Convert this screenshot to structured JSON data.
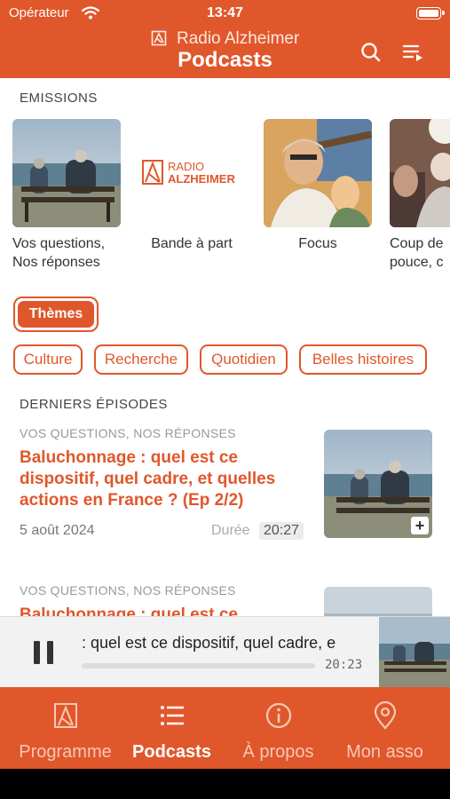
{
  "status": {
    "carrier": "Opérateur",
    "time": "13:47"
  },
  "header": {
    "brand": "Radio Alzheimer",
    "title": "Podcasts"
  },
  "emissions": {
    "label": "EMISSIONS",
    "items": [
      {
        "line1": "Vos questions,",
        "line2": "Nos réponses"
      },
      {
        "line1": "Bande à part",
        "line2": "",
        "logo_top": "RADIO",
        "logo_bottom": "ALZHEIMER"
      },
      {
        "line1": "Focus",
        "line2": ""
      },
      {
        "line1": "Coup de",
        "line2": "pouce, c"
      }
    ]
  },
  "themes": {
    "label": "Thèmes",
    "chips": [
      "Culture",
      "Recherche",
      "Quotidien",
      "Belles histoires"
    ]
  },
  "episodes": {
    "label": "DERNIERS ÉPISODES",
    "items": [
      {
        "show": "VOS QUESTIONS, NOS RÉPONSES",
        "title": "Baluchonnage : quel est ce dispositif, quel cadre, et quelles actions en France ? (Ep 2/2)",
        "date": "5 août 2024",
        "duration_label": "Durée",
        "duration": "20:27"
      },
      {
        "show": "VOS QUESTIONS, NOS RÉPONSES",
        "title": "Baluchonnage : quel est ce"
      }
    ]
  },
  "player": {
    "title": ": quel est ce dispositif, quel cadre, e",
    "time": "20:23",
    "progress": 0.0
  },
  "tabs": [
    {
      "label": "Programme",
      "icon": "radio-logo-icon",
      "active": false
    },
    {
      "label": "Podcasts",
      "icon": "list-icon",
      "active": true
    },
    {
      "label": "À propos",
      "icon": "info-icon",
      "active": false
    },
    {
      "label": "Mon asso",
      "icon": "location-pin-icon",
      "active": false
    }
  ],
  "colors": {
    "accent": "#e0572b",
    "accent_light": "#f8c8b3"
  }
}
